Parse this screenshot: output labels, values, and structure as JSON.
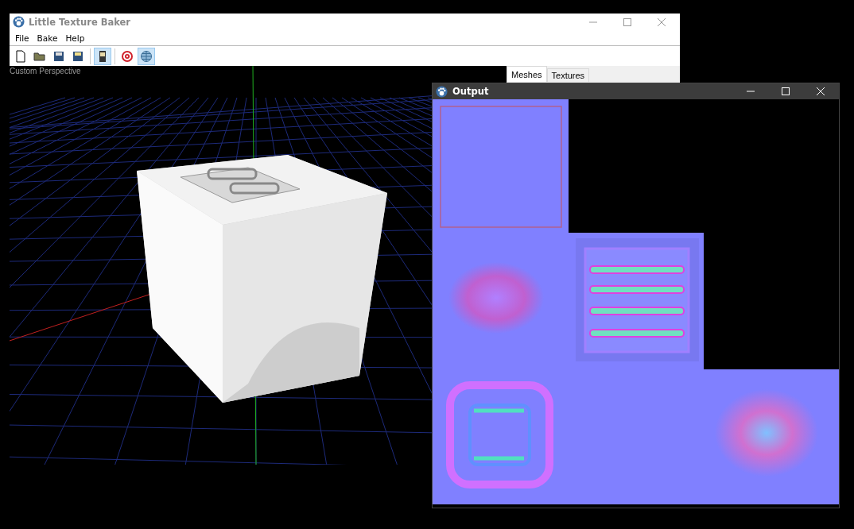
{
  "main_window": {
    "title": "Little Texture Baker"
  },
  "menu": [
    "File",
    "Bake",
    "Help"
  ],
  "toolbar": [
    {
      "kind": "new",
      "pressed": false
    },
    {
      "kind": "open",
      "pressed": false
    },
    {
      "kind": "save",
      "pressed": false
    },
    {
      "kind": "save-as",
      "pressed": false
    },
    {
      "kind": "separator"
    },
    {
      "kind": "bake",
      "pressed": true
    },
    {
      "kind": "separator"
    },
    {
      "kind": "target",
      "pressed": false
    },
    {
      "kind": "globe",
      "pressed": true
    }
  ],
  "viewport": {
    "label": "Custom Perspective"
  },
  "side_panel": {
    "tabs": [
      {
        "label": "Meshes",
        "selected": true
      },
      {
        "label": "Textures",
        "selected": false
      }
    ]
  },
  "output_window": {
    "title": "Output"
  }
}
